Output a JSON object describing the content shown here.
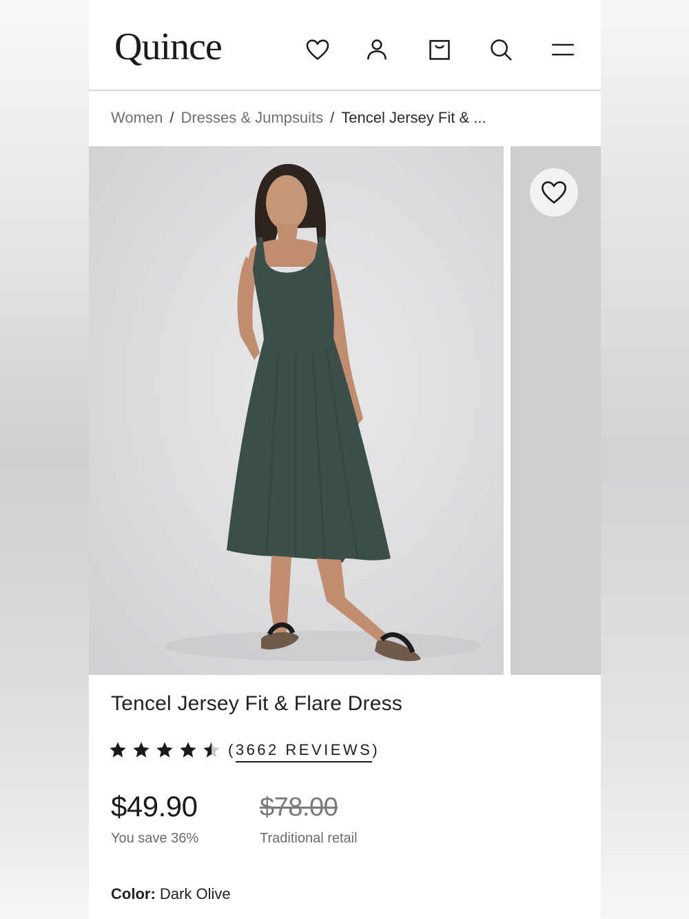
{
  "brand": {
    "logo_text": "Quince"
  },
  "header": {
    "icons": [
      "heart-icon",
      "user-icon",
      "shopping-bag-icon",
      "search-icon",
      "menu-icon"
    ]
  },
  "breadcrumb": {
    "items": [
      "Women",
      "Dresses & Jumpsuits"
    ],
    "separator": "/",
    "current": "Tencel Jersey Fit & ..."
  },
  "product": {
    "title": "Tencel Jersey Fit & Flare Dress",
    "rating": 4.5,
    "reviews_label": "3662 REVIEWS",
    "price": "$49.90",
    "savings": "You save 36%",
    "retail_price": "$78.00",
    "retail_label": "Traditional retail",
    "color_label": "Color:",
    "color_value": "Dark Olive",
    "dress_color": "#3c4f4a"
  }
}
